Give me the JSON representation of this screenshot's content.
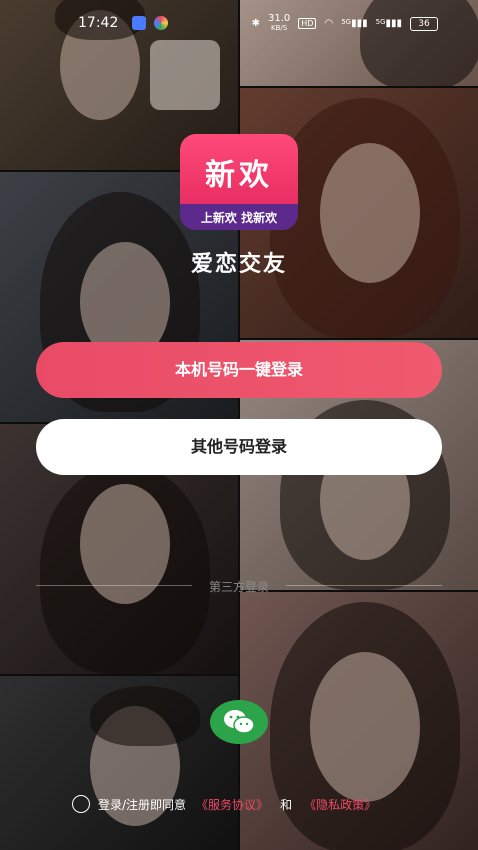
{
  "status_bar": {
    "time": "17:42",
    "net_speed_top": "31.0",
    "net_speed_unit": "KB/S",
    "hd_label": "HD",
    "signal_1": "5G",
    "signal_2": "5G",
    "battery": "36"
  },
  "brand": {
    "logo_text": "新欢",
    "logo_tagline": "上新欢 找新欢",
    "app_name": "爱恋交友",
    "primary_color": "#e94b67",
    "logo_band_color": "#5b2a8c"
  },
  "login": {
    "one_click_label": "本机号码一键登录",
    "other_number_label": "其他号码登录",
    "third_party_label": "第三方登录",
    "wechat_icon": "wechat-icon"
  },
  "agreement": {
    "prefix": "登录/注册即同意",
    "terms": "《服务协议》",
    "and": "和",
    "privacy": "《隐私政策》"
  }
}
